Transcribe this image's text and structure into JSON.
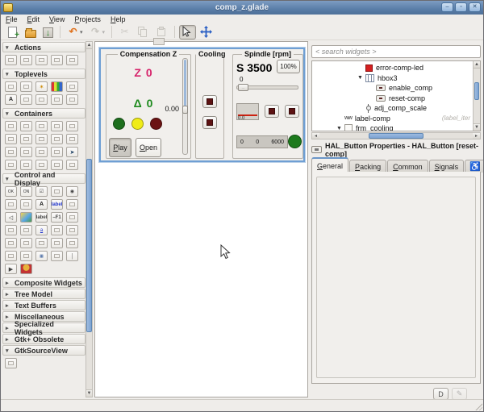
{
  "window": {
    "title": "comp_z.glade",
    "controls": [
      "minimize",
      "maximize",
      "close"
    ]
  },
  "menu": {
    "items": [
      "File",
      "Edit",
      "View",
      "Projects",
      "Help"
    ]
  },
  "toolbar": {
    "buttons": [
      {
        "name": "new"
      },
      {
        "name": "open"
      },
      {
        "name": "save"
      },
      {
        "sep": true
      },
      {
        "name": "undo",
        "dropdown": true
      },
      {
        "name": "redo",
        "dropdown": true,
        "disabled": true
      },
      {
        "sep": true
      },
      {
        "name": "cut",
        "disabled": true
      },
      {
        "name": "copy",
        "disabled": true
      },
      {
        "name": "paste",
        "disabled": true
      },
      {
        "sep": true
      },
      {
        "name": "selector",
        "active": true
      },
      {
        "name": "drag-resize"
      }
    ]
  },
  "palette": {
    "sections": [
      {
        "label": "Actions",
        "expanded": true,
        "icons": [
          "action-group",
          "action",
          "toggle-action",
          "radio-action",
          "separator-tool"
        ]
      },
      {
        "label": "Toplevels",
        "expanded": true,
        "icons": [
          "window",
          "dialog",
          "about-dialog",
          "color-selection-dialog",
          "file-chooser-dialog",
          "text-window",
          "input-dialog",
          "message-dialog",
          "recent-chooser-dialog",
          "font-selection-dialog"
        ]
      },
      {
        "label": "Containers",
        "expanded": true,
        "icons": [
          "hbox",
          "vbox",
          "table",
          "notebook",
          "frame",
          "hpaned",
          "file-chooser-button",
          "hbutton-box",
          "vpaned",
          "event-box",
          "toolbar",
          "menu-bar",
          "fixed",
          "layout",
          "mouse-pointer",
          "expander",
          "scrolled-window",
          "viewport",
          "aspect-frame",
          "alignment"
        ]
      },
      {
        "label": "Control and Display",
        "expanded": true,
        "icons": [
          "button",
          "toggle-button",
          "check-button",
          "combo-box",
          "radio-button",
          "switch",
          "spin-widget",
          "entry",
          "label",
          "font-button",
          "volume-button",
          "image",
          "text-label",
          "accel-label",
          "color-button",
          "hscale",
          "vscale",
          "link-button",
          "vscrollbar",
          "hscrollbar",
          "progress-bar",
          "level-bar",
          "text-view",
          "tree-view",
          "icon-view",
          "statusbar",
          "drawing-area",
          "calendar",
          "list-view",
          "separator",
          "arrow-tool",
          "badge"
        ]
      },
      {
        "label": "Composite Widgets",
        "expanded": false,
        "icons": []
      },
      {
        "label": "Tree Model",
        "expanded": false,
        "icons": []
      },
      {
        "label": "Text Buffers",
        "expanded": false,
        "icons": []
      },
      {
        "label": "Miscellaneous",
        "expanded": false,
        "icons": []
      },
      {
        "label": "Specialized Widgets",
        "expanded": false,
        "icons": []
      },
      {
        "label": "Gtk+ Obsolete",
        "expanded": false,
        "icons": []
      },
      {
        "label": "GtkSourceView",
        "expanded": true,
        "icons": [
          "source-view"
        ]
      }
    ]
  },
  "design": {
    "selection_color": "#6f9fd4",
    "compensation": {
      "title": "Compensation Z",
      "z_readout": "Z 0",
      "z_color": "#d6226a",
      "delta_readout": "Δ 0",
      "delta_color": "#1d8a1d",
      "scale_value": "0.00",
      "led_colors": [
        "#1e6f1e",
        "#f0ec17",
        "#6b1313"
      ],
      "play_label": "Play",
      "open_label": "Open"
    },
    "cooling": {
      "title": "Cooling"
    },
    "spindle": {
      "title": "Spindle [rpm]",
      "readout": "S 3500",
      "percent_label": "100%",
      "slider_label": "0",
      "meter_value": "0.0",
      "bar_ticks": [
        "0",
        "0",
        "6000"
      ],
      "led_color": "#1d7a1d"
    }
  },
  "widget_tree": {
    "search_value": "< search widgets >",
    "items": [
      {
        "label": "error-comp-led",
        "icon": "led",
        "indent": 4,
        "expanded": null
      },
      {
        "label": "hbox3",
        "icon": "hbox",
        "indent": 4,
        "expanded": true
      },
      {
        "label": "enable_comp",
        "icon": "hal-button",
        "indent": 5,
        "expanded": null
      },
      {
        "label": "reset-comp",
        "icon": "hal-button",
        "indent": 5,
        "expanded": null
      },
      {
        "label": "adj_comp_scale",
        "icon": "vscale",
        "indent": 4,
        "expanded": null
      },
      {
        "label": "label-comp",
        "icon": "label",
        "indent": 2,
        "expanded": null,
        "note": "(label_iter"
      },
      {
        "label": "frm_cooling",
        "icon": "frame",
        "indent": 2,
        "expanded": true
      }
    ]
  },
  "properties": {
    "header": "HAL_Button Properties - HAL_Button [reset-comp]",
    "tabs": [
      "General",
      "Packing",
      "Common",
      "Signals"
    ],
    "accessibility_tab": "♿",
    "footer_buttons": [
      {
        "label": "D",
        "name": "details"
      },
      {
        "label": "✎",
        "name": "edit",
        "disabled": true
      }
    ]
  }
}
